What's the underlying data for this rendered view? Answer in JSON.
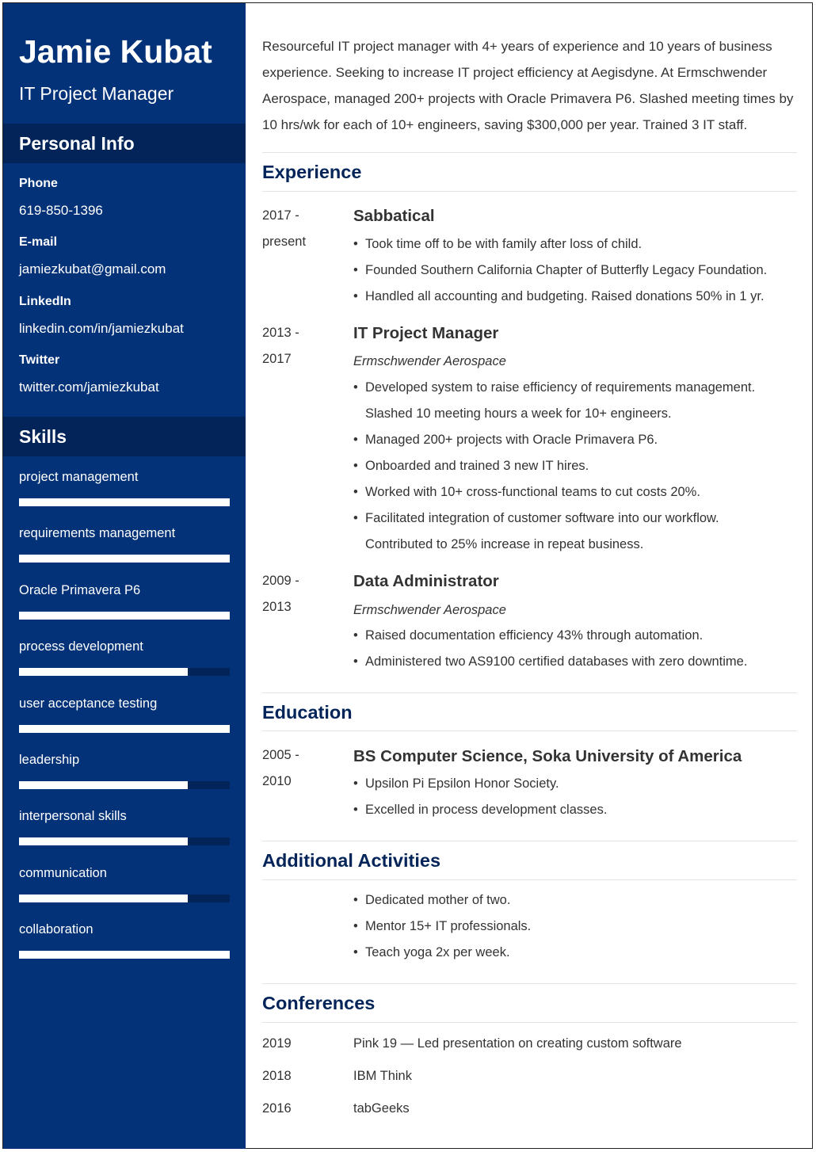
{
  "header": {
    "name": "Jamie Kubat",
    "title": "IT Project Manager"
  },
  "personal_info": {
    "heading": "Personal Info",
    "items": [
      {
        "label": "Phone",
        "value": "619-850-1396"
      },
      {
        "label": "E-mail",
        "value": "jamiezkubat@gmail.com"
      },
      {
        "label": "LinkedIn",
        "value": "linkedin.com/in/jamiezkubat"
      },
      {
        "label": "Twitter",
        "value": "twitter.com/jamiezkubat"
      }
    ]
  },
  "skills": {
    "heading": "Skills",
    "items": [
      {
        "name": "project management",
        "level": 1.0
      },
      {
        "name": "requirements management",
        "level": 1.0
      },
      {
        "name": "Oracle Primavera P6",
        "level": 1.0
      },
      {
        "name": "process development",
        "level": 0.8
      },
      {
        "name": "user acceptance testing",
        "level": 1.0
      },
      {
        "name": "leadership",
        "level": 0.8
      },
      {
        "name": "interpersonal skills",
        "level": 0.8
      },
      {
        "name": "communication",
        "level": 0.8
      },
      {
        "name": "collaboration",
        "level": 1.0
      }
    ]
  },
  "summary": "Resourceful IT project manager with 4+ years of experience and 10 years of business experience. Seeking to increase IT project efficiency at Aegisdyne. At Ermschwender Aerospace, managed 200+ projects with Oracle Primavera P6. Slashed meeting times by 10 hrs/wk for each of 10+ engineers, saving $300,000 per year. Trained 3 IT staff.",
  "experience": {
    "heading": "Experience",
    "jobs": [
      {
        "date_start": "2017 -",
        "date_end": "present",
        "title": "Sabbatical",
        "company": "",
        "bullets": [
          "Took time off to be with family after loss of child.",
          "Founded Southern California Chapter of Butterfly Legacy Foundation.",
          "Handled all accounting and budgeting. Raised donations 50% in 1 yr."
        ]
      },
      {
        "date_start": "2013 -",
        "date_end": "2017",
        "title": "IT Project Manager",
        "company": "Ermschwender Aerospace",
        "bullets": [
          "Developed system to raise efficiency of requirements management. Slashed 10 meeting hours a week for 10+ engineers.",
          "Managed 200+ projects with Oracle Primavera P6.",
          "Onboarded and trained 3 new IT hires.",
          "Worked with 10+ cross-functional teams to cut costs 20%.",
          "Facilitated integration of customer software into our workflow. Contributed to 25% increase in repeat business."
        ]
      },
      {
        "date_start": "2009 -",
        "date_end": "2013",
        "title": "Data Administrator",
        "company": "Ermschwender Aerospace",
        "bullets": [
          "Raised documentation efficiency 43% through automation.",
          "Administered two AS9100 certified databases with zero downtime."
        ]
      }
    ]
  },
  "education": {
    "heading": "Education",
    "date_start": "2005 -",
    "date_end": "2010",
    "degree": "BS Computer Science, Soka University of America",
    "bullets": [
      "Upsilon Pi Epsilon Honor Society.",
      "Excelled in process development classes."
    ]
  },
  "activities": {
    "heading": "Additional Activities",
    "bullets": [
      "Dedicated mother of two.",
      "Mentor 15+ IT professionals.",
      "Teach yoga 2x per week."
    ]
  },
  "conferences": {
    "heading": "Conferences",
    "items": [
      {
        "year": "2019",
        "name": "Pink 19 — Led presentation on creating custom software"
      },
      {
        "year": "2018",
        "name": "IBM Think"
      },
      {
        "year": "2016",
        "name": "tabGeeks"
      }
    ]
  },
  "colors": {
    "sidebar": "#033278",
    "sidebar_header": "#022459",
    "heading": "#022459",
    "text": "#333333"
  }
}
